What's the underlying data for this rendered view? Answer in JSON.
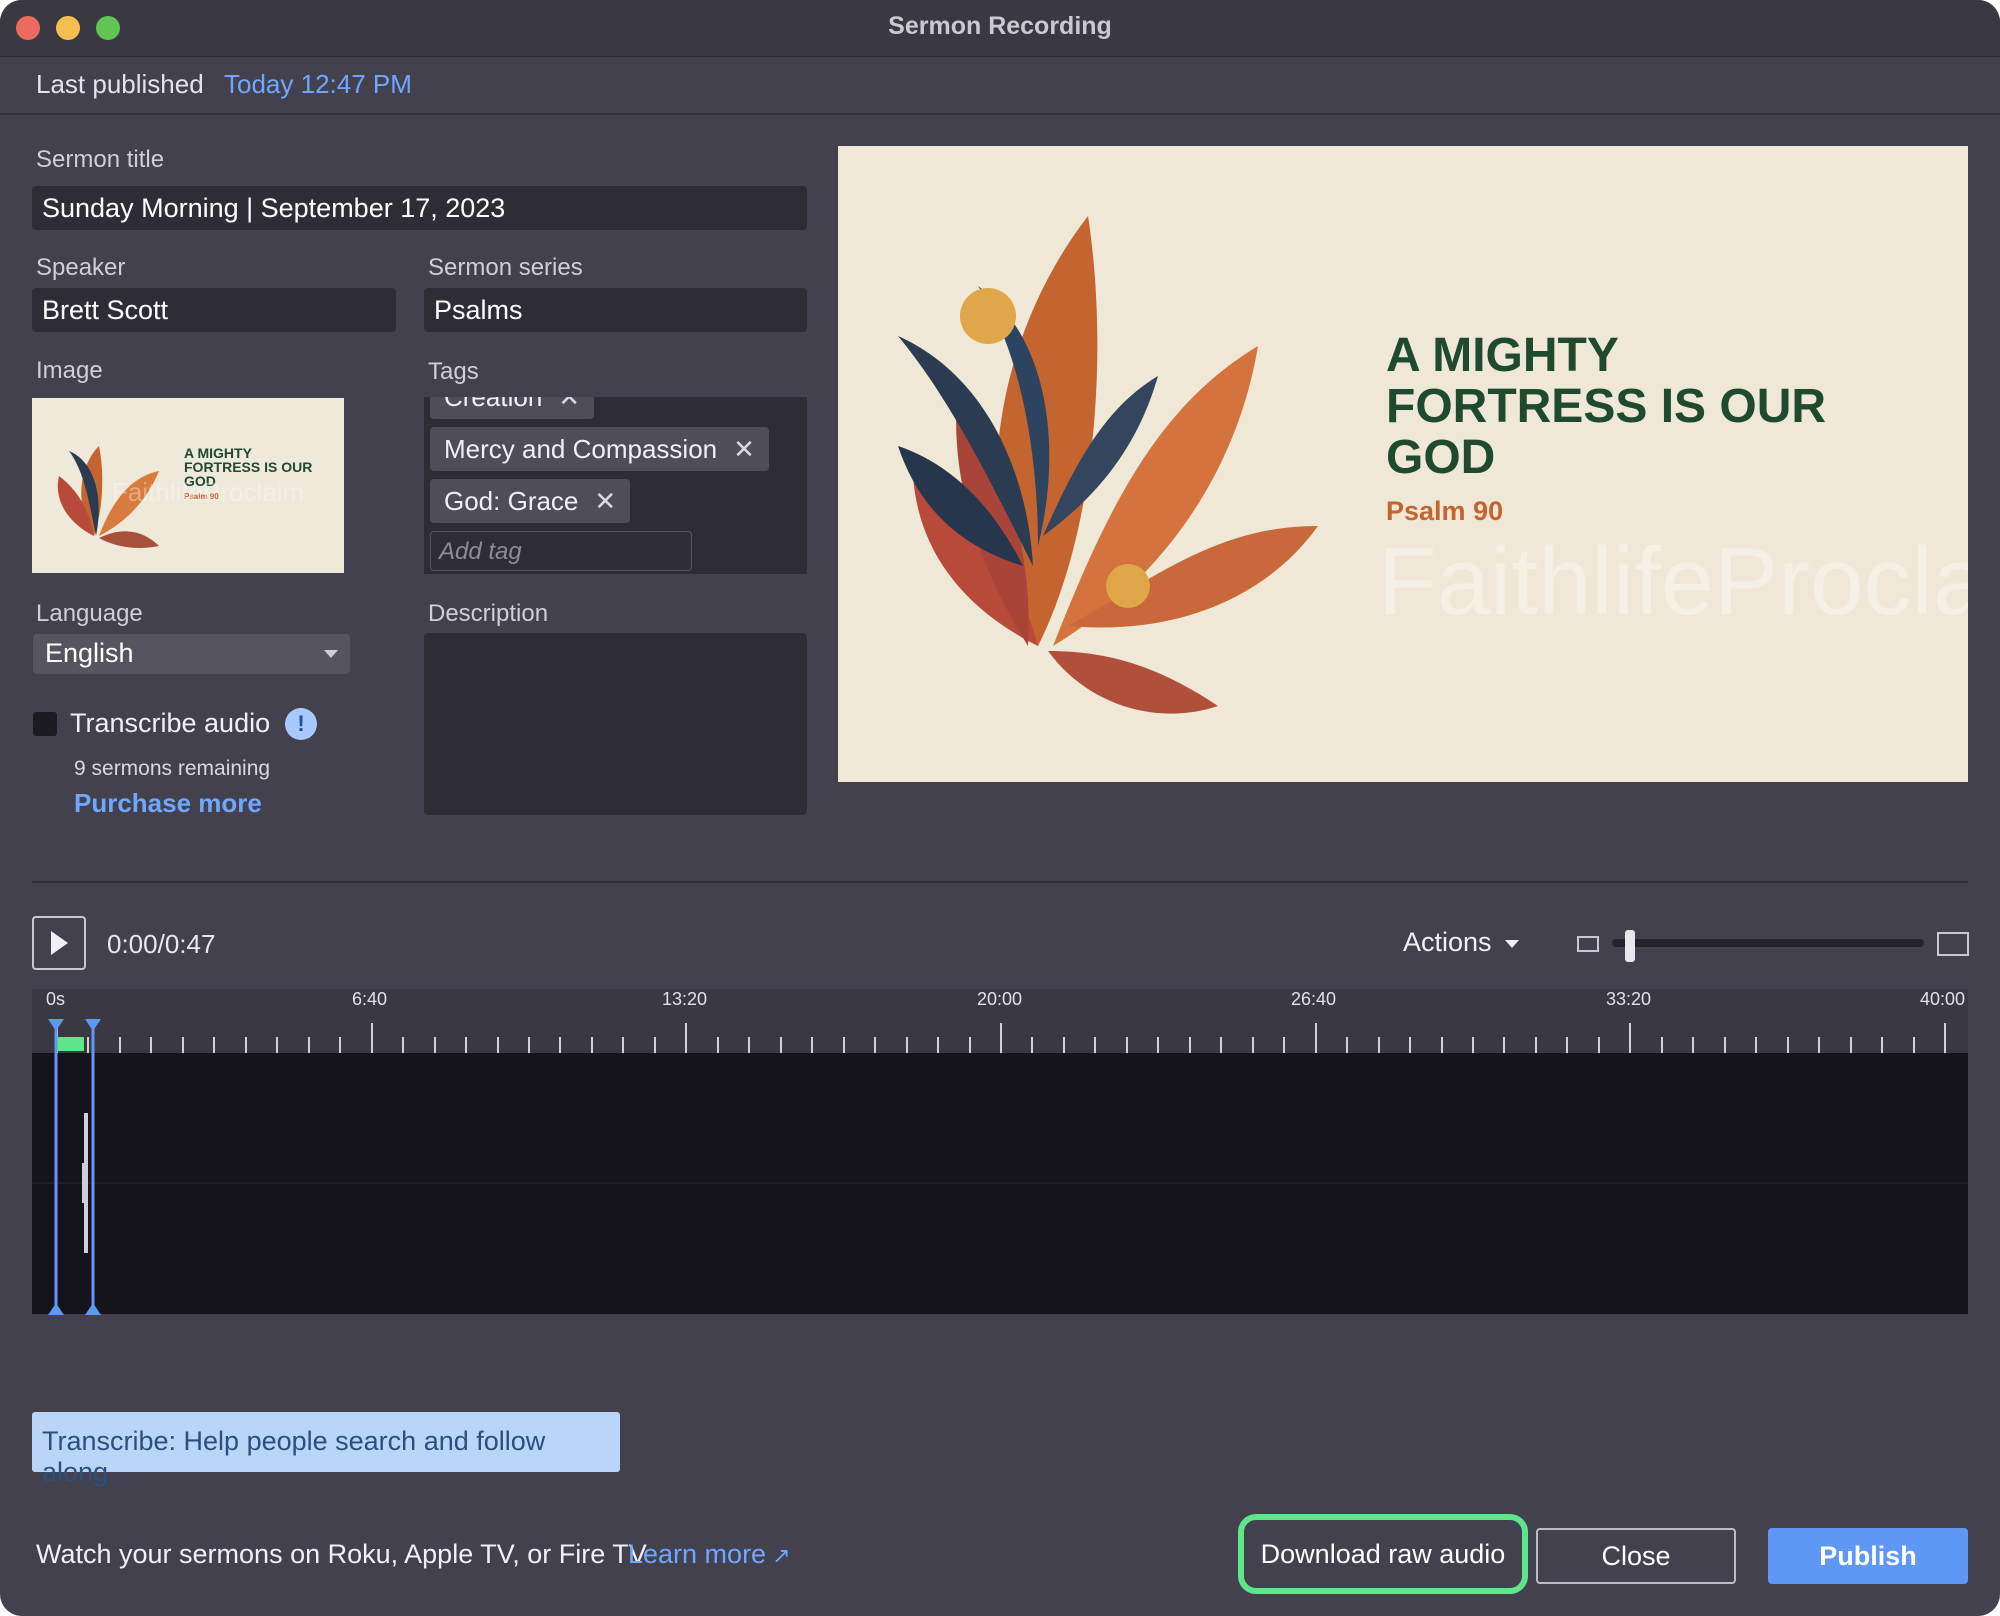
{
  "window": {
    "title": "Sermon Recording"
  },
  "published": {
    "label": "Last published",
    "value": "Today 12:47 PM"
  },
  "form": {
    "title_label": "Sermon title",
    "title_value": "Sunday Morning | September 17, 2023",
    "speaker_label": "Speaker",
    "speaker_value": "Brett Scott",
    "series_label": "Sermon series",
    "series_value": "Psalms",
    "image_label": "Image",
    "tags_label": "Tags",
    "tags": [
      "Creation",
      "Mercy and Compassion",
      "God: Grace"
    ],
    "add_tag_placeholder": "Add tag",
    "language_label": "Language",
    "language_value": "English",
    "transcribe_label": "Transcribe audio",
    "remaining_text": "9 sermons remaining",
    "purchase_link": "Purchase more",
    "description_label": "Description"
  },
  "preview": {
    "heading_lines": [
      "A MIGHTY",
      "FORTRESS IS OUR",
      "GOD"
    ],
    "subtitle": "Psalm 90",
    "watermark": "FaithlifeProclaim",
    "colors": {
      "heading": "#1f4a2e",
      "subtitle": "#c4642f",
      "background": "#efe8d6"
    }
  },
  "player": {
    "time": "0:00/0:47",
    "actions_label": "Actions",
    "ruler_labels": [
      "0s",
      "6:40",
      "13:20",
      "20:00",
      "26:40",
      "33:20",
      "40:00"
    ]
  },
  "banner": {
    "text": "Transcribe: Help people search and follow along."
  },
  "footer": {
    "text": "Watch your sermons on Roku, Apple TV, or Fire TV",
    "learn_more": "Learn more",
    "download_label": "Download raw audio",
    "close_label": "Close",
    "publish_label": "Publish"
  },
  "colors": {
    "accent": "#5e97f6",
    "link": "#6fa7ff",
    "highlight": "#5ee68a",
    "background": "#42414d"
  }
}
